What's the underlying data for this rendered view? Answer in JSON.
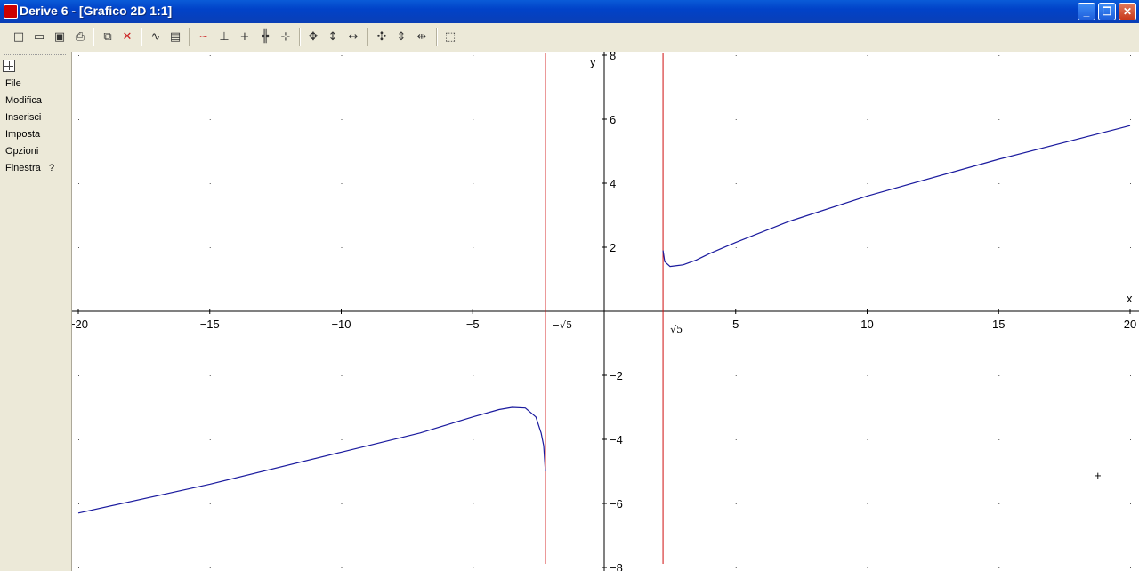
{
  "window": {
    "title": "Derive 6 - [Grafico 2D 1:1]"
  },
  "controls": {
    "minimize": "_",
    "maximize": "❐",
    "close": "✕"
  },
  "menu": [
    {
      "label": "File",
      "bind": "file"
    },
    {
      "label": "Modifica",
      "bind": "edit"
    },
    {
      "label": "Inserisci",
      "bind": "insert"
    },
    {
      "label": "Imposta",
      "bind": "set"
    },
    {
      "label": "Opzioni",
      "bind": "options"
    },
    {
      "label": "Finestra",
      "bind": "window"
    },
    {
      "label": "?",
      "bind": "help"
    }
  ],
  "toolbar_icons": [
    "new-icon",
    "open-icon",
    "save-icon",
    "print-icon",
    "copy-icon",
    "delete-icon",
    "plot-icon",
    "annotate-icon",
    "graph-icon",
    "axes-icon",
    "crosshair-icon",
    "grid-icon",
    "trace-icon",
    "pan-icon",
    "vertical-move-icon",
    "horizontal-move-icon",
    "zoom-in-icon",
    "zoom-vertical-icon",
    "zoom-horizontal-icon",
    "select-range-icon"
  ],
  "plot": {
    "x_axis_label": "x",
    "y_axis_label": "y",
    "x_ticks": [
      "-20",
      "-15",
      "-10",
      "-5",
      "5",
      "10",
      "15",
      "20"
    ],
    "y_ticks": [
      "8",
      "6",
      "4",
      "2",
      "-2",
      "-4",
      "-6",
      "-8"
    ],
    "asymptote_labels": [
      "−√5",
      "√5"
    ],
    "curve_color": "#1a1a9e",
    "asymptote_color": "#d01010",
    "cursor": "+"
  },
  "chart_data": {
    "type": "line",
    "xlim": [
      -20,
      20
    ],
    "ylim": [
      -8,
      8
    ],
    "x_ticks": [
      -20,
      -15,
      -10,
      -5,
      5,
      10,
      15,
      20
    ],
    "y_ticks": [
      -8,
      -6,
      -4,
      -2,
      2,
      4,
      6,
      8
    ],
    "vertical_asymptotes": [
      -2.236,
      2.236
    ],
    "series": [
      {
        "x": [
          -20,
          -15,
          -10,
          -7,
          -5,
          -4,
          -3.5,
          -3,
          -2.6,
          -2.4,
          -2.3,
          -2.236
        ],
        "y": [
          -6.3,
          -5.4,
          -4.4,
          -3.8,
          -3.3,
          -3.07,
          -3.0,
          -3.02,
          -3.3,
          -3.8,
          -4.2,
          -5.0
        ]
      },
      {
        "x": [
          2.236,
          2.3,
          2.5,
          3,
          3.5,
          4,
          5,
          7,
          10,
          15,
          20
        ],
        "y": [
          1.9,
          1.55,
          1.4,
          1.45,
          1.6,
          1.8,
          2.15,
          2.8,
          3.6,
          4.75,
          5.8
        ]
      }
    ]
  }
}
